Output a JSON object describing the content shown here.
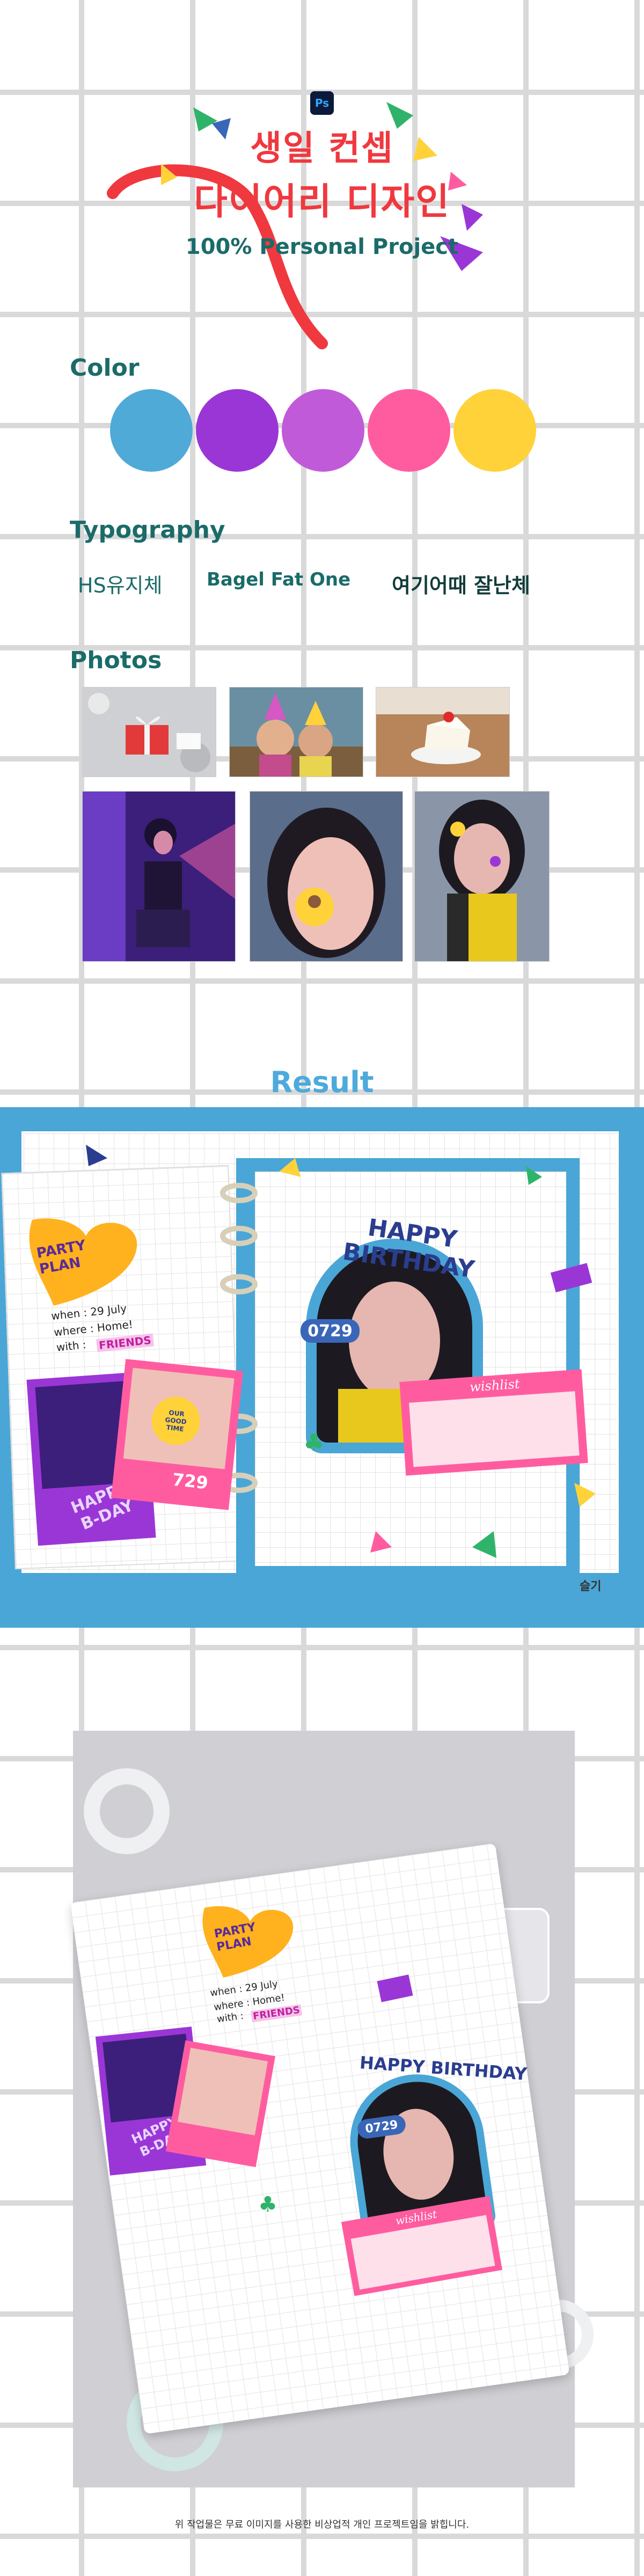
{
  "header": {
    "app_badge": "Ps",
    "title_line1": "생일 컨셉",
    "title_line2": "다이어리 디자인",
    "subtitle": "100% Personal Project"
  },
  "color_section": {
    "heading": "Color",
    "swatches": [
      "#4faad8",
      "#9b36d6",
      "#c15ad8",
      "#ff5ca0",
      "#ffd23a"
    ]
  },
  "typography_section": {
    "heading": "Typography",
    "fonts": [
      "HS유지체",
      "Bagel Fat One",
      "여기어때 잘난체"
    ]
  },
  "photos_section": {
    "heading": "Photos"
  },
  "result_section": {
    "heading": "Result"
  },
  "diary": {
    "party_plan_label": "PARTY\nPLAN",
    "when_line": "when : 29 July",
    "where_line": "where : Home!",
    "with_label": "with :",
    "with_value": "FRIENDS",
    "happy_bday_label": "HAPPY\nB-DAY",
    "date_tag": "729",
    "our_good_time": "OUR\nGOOD\nTIME",
    "happy_birthday_title": "HAPPY BIRTHDAY",
    "date_pill": "0729",
    "wishlist_label": "wishlist",
    "signature": "슬기"
  },
  "mockup": {
    "party_plan_label": "PARTY\nPLAN",
    "when_line": "when : 29 July",
    "where_line": "where : Home!",
    "with_label": "with :",
    "with_value": "FRIENDS",
    "happy_bday_label": "HAPPY\nB-DAY",
    "happy_birthday_title": "HAPPY BIRTHDAY",
    "date_pill": "0729",
    "wishlist_label": "wishlist"
  },
  "footer": {
    "note": "위 작업물은 무료 이미지를 사용한 비상업적 개인 프로젝트임을 밝힙니다."
  }
}
